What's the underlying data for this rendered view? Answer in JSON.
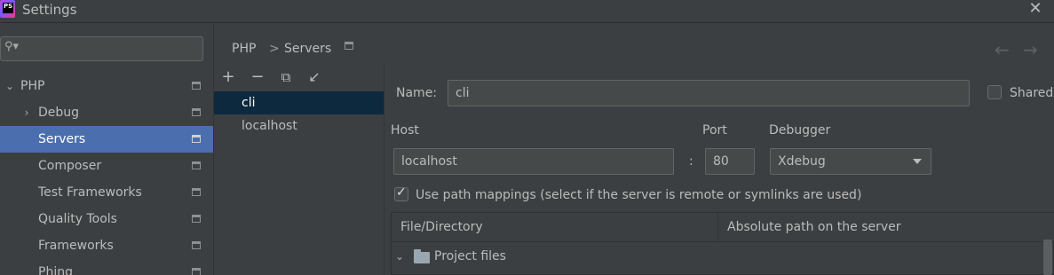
{
  "window": {
    "title": "Settings",
    "app_logo_text": "PS"
  },
  "search": {
    "placeholder": "",
    "value": ""
  },
  "sidebar": {
    "items": [
      {
        "label": "PHP",
        "expanded": true
      },
      {
        "label": "Debug",
        "expanded": false
      },
      {
        "label": "Servers",
        "selected": true
      },
      {
        "label": "Composer"
      },
      {
        "label": "Test Frameworks"
      },
      {
        "label": "Quality Tools"
      },
      {
        "label": "Frameworks"
      },
      {
        "label": "Phing"
      }
    ]
  },
  "breadcrumb": {
    "parent": "PHP",
    "separator": ">",
    "current": "Servers"
  },
  "servers": {
    "items": [
      "cli",
      "localhost"
    ],
    "selected": "cli"
  },
  "form": {
    "name_label": "Name:",
    "name_value": "cli",
    "shared_label": "Shared",
    "shared_checked": false,
    "host_label": "Host",
    "host_value": "localhost",
    "port_separator": ":",
    "port_label": "Port",
    "port_value": "80",
    "debugger_label": "Debugger",
    "debugger_value": "Xdebug",
    "path_mappings_label": "Use path mappings (select if the server is remote or symlinks are used)",
    "path_mappings_checked": true
  },
  "mappings_table": {
    "columns": [
      "File/Directory",
      "Absolute path on the server"
    ],
    "rows": [
      {
        "label": "Project files",
        "expanded": true
      }
    ]
  },
  "colors": {
    "background": "#3c3f41",
    "selection": "#4b6eaf",
    "list_selection": "#0d293e"
  }
}
